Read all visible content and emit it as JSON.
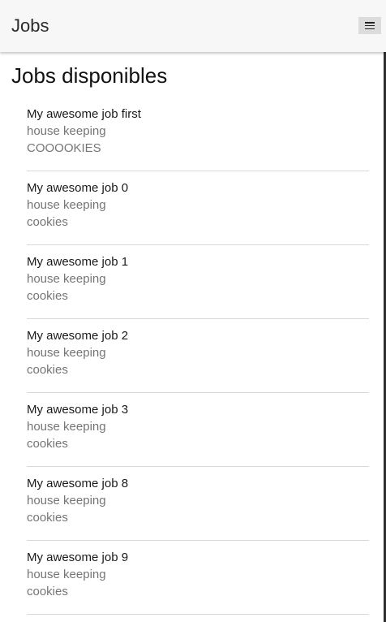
{
  "app_bar": {
    "title": "Jobs",
    "menu_icon": "hamburger-menu-icon"
  },
  "main": {
    "heading": "Jobs disponibles",
    "jobs": [
      {
        "title": "My awesome job first",
        "category": "house keeping",
        "detail": "COOOOKIES"
      },
      {
        "title": "My awesome job 0",
        "category": "house keeping",
        "detail": "cookies"
      },
      {
        "title": "My awesome job 1",
        "category": "house keeping",
        "detail": "cookies"
      },
      {
        "title": "My awesome job 2",
        "category": "house keeping",
        "detail": "cookies"
      },
      {
        "title": "My awesome job 3",
        "category": "house keeping",
        "detail": "cookies"
      },
      {
        "title": "My awesome job 8",
        "category": "house keeping",
        "detail": "cookies"
      },
      {
        "title": "My awesome job 9",
        "category": "house keeping",
        "detail": "cookies"
      }
    ]
  },
  "colors": {
    "app_bar_bg": "#f7f7f7",
    "title_text": "#111111",
    "secondary_text": "#757575",
    "divider": "#d8d8d8"
  }
}
